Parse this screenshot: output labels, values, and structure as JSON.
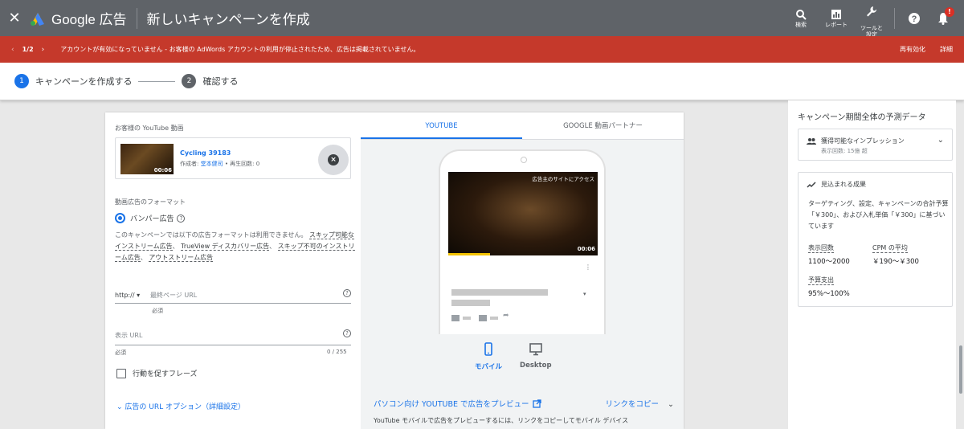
{
  "topbar": {
    "brand": "Google 広告",
    "title": "新しいキャンペーンを作成",
    "tools": [
      {
        "label": "検索",
        "icon": "search-icon"
      },
      {
        "label": "レポート",
        "icon": "reports-icon"
      },
      {
        "label": "ツールと\n設定",
        "icon": "wrench-icon"
      }
    ],
    "notification_badge": "!"
  },
  "alert": {
    "pager": "1/2",
    "message": "アカウントが有効になっていません - お客様の AdWords アカウントの利用が停止されたため、広告は掲載されていません。",
    "reactivate": "再有効化",
    "details": "詳細",
    "color": "#c5392b"
  },
  "steps": [
    {
      "num": "1",
      "label": "キャンペーンを作成する",
      "color": "#1a73e8"
    },
    {
      "num": "2",
      "label": "確認する",
      "color": "#5f6368"
    }
  ],
  "form": {
    "your_video_label": "お客様の YouTube 動画",
    "video": {
      "title": "Cycling 39183",
      "creator_label": "作成者:",
      "creator": "堂本健司",
      "views": " • 再生回数: 0",
      "duration": "00:06"
    },
    "format_label": "動画広告のフォーマット",
    "bumper_label": "バンパー広告",
    "desc_prefix": "このキャンペーンでは以下の広告フォーマットは利用できません。",
    "desc_items": [
      "スキップ可能なインストリーム広告",
      "TrueView ディスカバリー広告",
      "スキップ不可のインストリーム広告",
      "アウトストリーム広告"
    ],
    "separator": "、",
    "protocol": "http://",
    "final_url_placeholder": "最終ページ URL",
    "required1": "必須",
    "display_url_placeholder": "表示 URL",
    "required2": "必須",
    "char_count": "0 / 255",
    "cta_label": "行動を促すフレーズ",
    "url_options": "広告の URL オプション（詳細設定）"
  },
  "preview": {
    "tabs": [
      "YOUTUBE",
      "GOOGLE 動画パートナー"
    ],
    "overlay_text": "広告主のサイトにアクセス",
    "duration": "00:06",
    "devices": [
      {
        "label": "モバイル",
        "icon": "mobile-icon"
      },
      {
        "label": "Desktop",
        "icon": "desktop-icon"
      }
    ],
    "preview_link": "パソコン向け YOUTUBE で広告をプレビュー",
    "copy_link": "リンクをコピー",
    "description": "YouTube モバイルで広告をプレビューするには、リンクをコピーしてモバイル デバイス"
  },
  "sidebar": {
    "title": "キャンペーン期間全体の予測データ",
    "impressions_title": "獲得可能なインプレッション",
    "impressions_sub": "表示回数: 15億 超",
    "results_title": "見込まれる成果",
    "results_text": "ターゲティング、設定、キャンペーンの合計予算「￥300」、および入札単価「￥300」に基づいています",
    "metrics": [
      {
        "label": "表示回数",
        "value": "1100～2000"
      },
      {
        "label": "CPM の平均",
        "value": "￥190～￥300"
      },
      {
        "label": "予算支出",
        "value": "95%～100%"
      }
    ]
  }
}
